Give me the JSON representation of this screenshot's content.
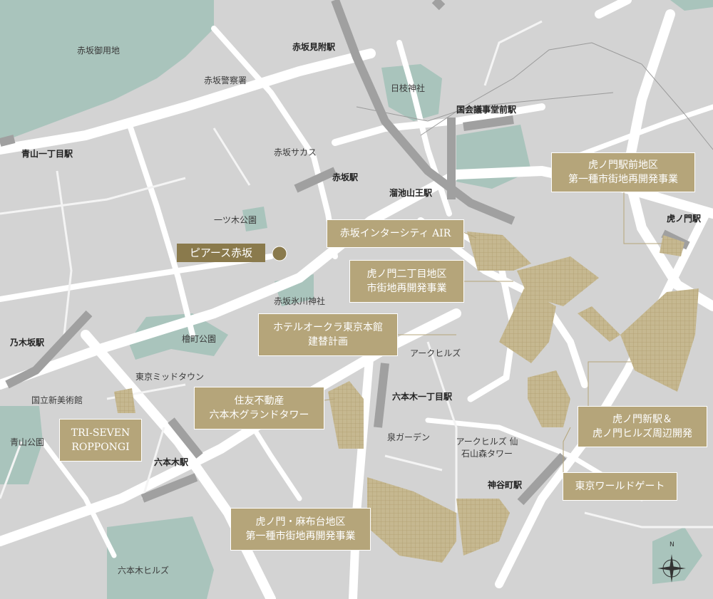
{
  "map": {
    "colors": {
      "base": "#d3d3d3",
      "road": "#ffffff",
      "park": "#a9c4bc",
      "rail": "#a0a0a0",
      "project": "#b5a57a",
      "marker": "#8a7a4c"
    },
    "subject": {
      "label": "ピアース赤坂",
      "marker_icon": "location-dot-icon"
    },
    "stations": [
      "赤坂見附駅",
      "国会議事堂前駅",
      "青山一丁目駅",
      "赤坂駅",
      "溜池山王駅",
      "虎ノ門駅",
      "乃木坂駅",
      "六本木一丁目駅",
      "六本木駅",
      "神谷町駅"
    ],
    "places": [
      "赤坂御用地",
      "赤坂警察署",
      "日枝神社",
      "赤坂サカス",
      "一ツ木公園",
      "赤坂氷川神社",
      "檜町公園",
      "東京ミッドタウン",
      "国立新美術館",
      "青山公園",
      "アークヒルズ",
      "泉ガーデン",
      "アークヒルズ 仙石山森タワー",
      "六本木ヒルズ"
    ],
    "projects": [
      [
        "虎ノ門駅前地区",
        "第一種市街地再開発事業"
      ],
      [
        "赤坂インターシティ AIR"
      ],
      [
        "虎ノ門二丁目地区",
        "市街地再開発事業"
      ],
      [
        "ホテルオークラ東京本館",
        "建替計画"
      ],
      [
        "住友不動産",
        "六本木グランドタワー"
      ],
      [
        "TRI-SEVEN",
        "ROPPONGI"
      ],
      [
        "虎ノ門新駅＆",
        "虎ノ門ヒルズ周辺開発"
      ],
      [
        "東京ワールドゲート"
      ],
      [
        "虎ノ門・麻布台地区",
        "第一種市街地再開発事業"
      ]
    ],
    "compass": {
      "icon": "compass-icon",
      "label": "N"
    }
  }
}
